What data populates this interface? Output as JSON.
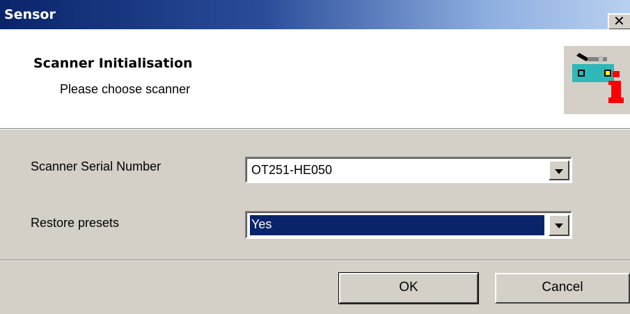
{
  "window": {
    "title": "Sensor",
    "close_glyph": "✕"
  },
  "header": {
    "heading": "Scanner Initialisation",
    "subheading": "Please choose scanner",
    "icon": "scanner-info-icon"
  },
  "form": {
    "serial_label": "Scanner Serial Number",
    "serial_value": "OT251-HE050",
    "restore_label": "Restore presets",
    "restore_value": "Yes"
  },
  "buttons": {
    "ok_label": "OK",
    "cancel_label": "Cancel"
  },
  "colors": {
    "title_bar_start": "#0a246a",
    "title_bar_end": "#b8d0f0",
    "selection": "#0a246a",
    "dialog_face": "#d4d0c8"
  }
}
